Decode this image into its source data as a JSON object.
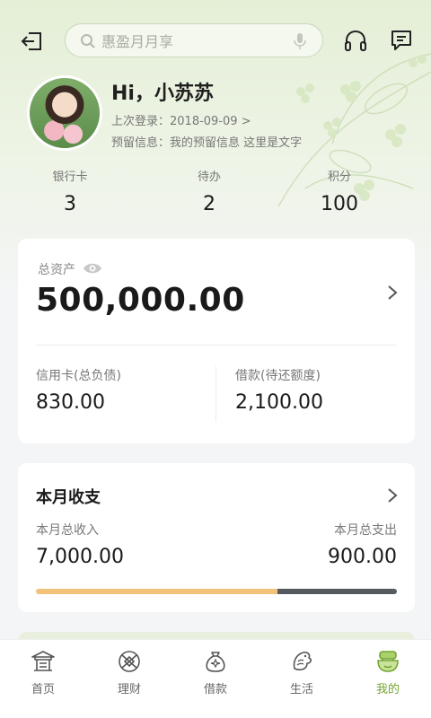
{
  "search": {
    "placeholder": "惠盈月月享"
  },
  "profile": {
    "greeting": "Hi，小苏苏",
    "last_login_label": "上次登录：",
    "last_login_value": "2018-09-09 >",
    "reserve_label": "预留信息：",
    "reserve_value": "我的预留信息 这里是文字"
  },
  "stats": [
    {
      "label": "银行卡",
      "value": "3"
    },
    {
      "label": "待办",
      "value": "2"
    },
    {
      "label": "积分",
      "value": "100"
    }
  ],
  "assets": {
    "label": "总资产",
    "value": "500,000.00",
    "credit_label": "信用卡(总负债)",
    "credit_value": "830.00",
    "loan_label": "借款(待还额度)",
    "loan_value": "2,100.00"
  },
  "monthly": {
    "title": "本月收支",
    "income_label": "本月总收入",
    "income_value": "7,000.00",
    "expense_label": "本月总支出",
    "expense_value": "900.00",
    "income_fraction": 0.67
  },
  "tabs": [
    {
      "label": "首页",
      "icon": "home-pavilion-icon"
    },
    {
      "label": "理财",
      "icon": "finance-ball-icon"
    },
    {
      "label": "借款",
      "icon": "money-bag-icon"
    },
    {
      "label": "生活",
      "icon": "life-fish-icon"
    },
    {
      "label": "我的",
      "icon": "profile-pot-icon",
      "active": true
    }
  ],
  "colors": {
    "accent": "#74a532",
    "income_bar": "#f2c27b",
    "expense_bar": "#555a5f"
  }
}
